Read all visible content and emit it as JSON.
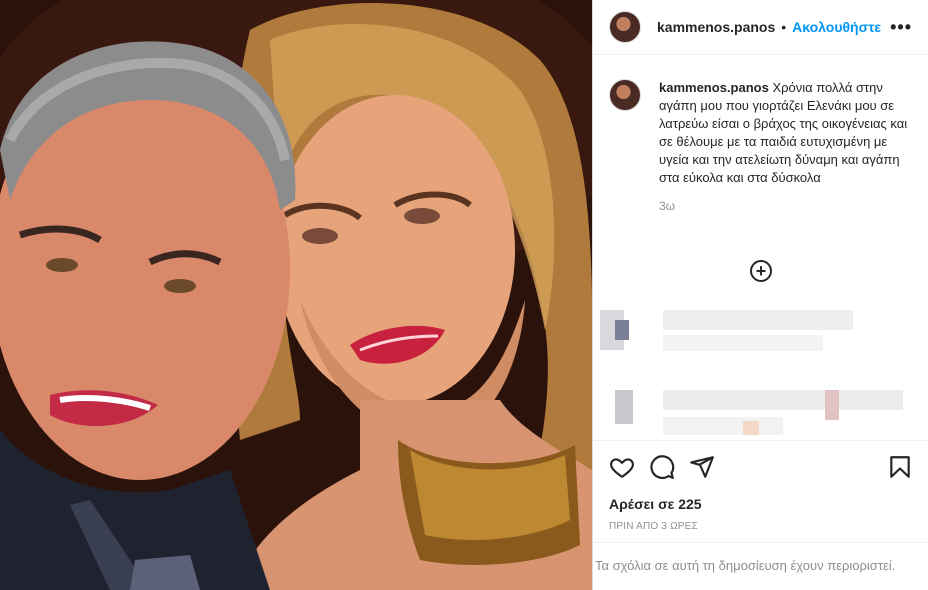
{
  "post": {
    "image_alt": "Selfie of a man and a woman",
    "header": {
      "username": "kammenos.panos",
      "separator": "•",
      "follow_label": "Ακολουθήστε",
      "more_label": "•••"
    },
    "caption": {
      "username": "kammenos.panos",
      "text": "Χρόνια πολλά στην αγάπη μου που γιορτάζει Ελενάκι μου σε λατρεύω είσαι ο βράχος της οικογένειας και σε θέλουμε με τα παιδιά ευτυχισμένη με υγεία και την ατελείωτη δύναμη και αγάπη στα εύκολα και στα δύσκολα",
      "time": "3ω"
    },
    "load_more_label": "+",
    "likes": "Αρέσει σε 225",
    "posted": "ΠΡΙΝ ΑΠΟ 3 ΩΡΕΣ",
    "comments_restricted": "Τα σχόλια σε αυτή τη δημοσίευση έχουν περιοριστεί."
  },
  "icons": [
    "heart-icon",
    "comment-icon",
    "share-icon",
    "bookmark-icon",
    "add-circle-icon",
    "more-icon"
  ],
  "colors": {
    "accent": "#0095f6",
    "text": "#262626",
    "muted": "#8e8e8e",
    "border": "#dbdbdb"
  }
}
